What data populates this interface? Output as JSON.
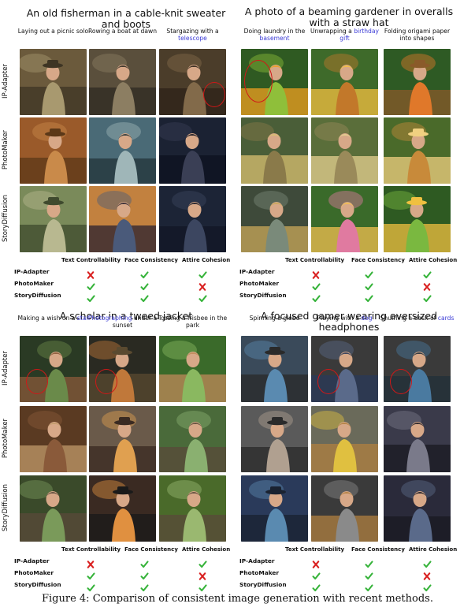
{
  "panels": [
    {
      "title": "An old fisherman in a cable-knit sweater and boots",
      "prompts": [
        {
          "pre": "Laying out a picnic solo",
          "hl": "",
          "post": ""
        },
        {
          "pre": "Rowing a boat at dawn",
          "hl": "",
          "post": ""
        },
        {
          "pre": "Stargazing with a ",
          "hl": "telescope",
          "post": ""
        }
      ],
      "methods": [
        "IP-Adapter",
        "PhotoMaker",
        "StoryDiffusion"
      ],
      "metrics": [
        "Text Controllability",
        "Face Consistency",
        "Attire Cohesion"
      ],
      "results": [
        [
          "fail",
          "pass",
          "pass"
        ],
        [
          "pass",
          "pass",
          "fail"
        ],
        [
          "pass",
          "pass",
          "pass"
        ]
      ]
    },
    {
      "title": "A photo of a beaming gardener in overalls with a straw hat",
      "prompts": [
        {
          "pre": "Doing laundry in the ",
          "hl": "basement",
          "post": ""
        },
        {
          "pre": "Unwrapping a ",
          "hl": "birthday gift",
          "post": ""
        },
        {
          "pre": "Folding origami paper into shapes",
          "hl": "",
          "post": ""
        }
      ],
      "methods": [
        "IP-Adapter",
        "PhotoMaker",
        "StoryDiffusion"
      ],
      "metrics": [
        "Text Controllability",
        "Face Consistency",
        "Attire Cohesion"
      ],
      "results": [
        [
          "fail",
          "pass",
          "pass"
        ],
        [
          "pass",
          "pass",
          "fail"
        ],
        [
          "pass",
          "pass",
          "pass"
        ]
      ]
    },
    {
      "title": "A scholar in a tweed jacket",
      "prompts": [
        {
          "pre": "Making a wish on a ",
          "hl": "star",
          "post": ""
        },
        {
          "pre": "",
          "hl": "Photographing",
          "post": " under a sunset"
        },
        {
          "pre": "Tossing a frisbee in the park",
          "hl": "",
          "post": ""
        }
      ],
      "methods": [
        "IP-Adapter",
        "PhotoMaker",
        "StoryDiffusion"
      ],
      "metrics": [
        "Text Controllability",
        "Face Consistency",
        "Attire Cohesion"
      ],
      "results": [
        [
          "fail",
          "pass",
          "pass"
        ],
        [
          "pass",
          "pass",
          "fail"
        ],
        [
          "pass",
          "pass",
          "pass"
        ]
      ]
    },
    {
      "title": "A focused gamer wearing oversized headphones",
      "prompts": [
        {
          "pre": "Spinning a globe",
          "hl": "",
          "post": ""
        },
        {
          "pre": "Playing with a ",
          "hl": "dog",
          "post": ""
        },
        {
          "pre": "Shuffling a deck of ",
          "hl": "cards",
          "post": ""
        }
      ],
      "methods": [
        "IP-Adapter",
        "PhotoMaker",
        "StoryDiffusion"
      ],
      "metrics": [
        "Text Controllability",
        "Face Consistency",
        "Attire Cohesion"
      ],
      "results": [
        [
          "fail",
          "pass",
          "pass"
        ],
        [
          "pass",
          "pass",
          "fail"
        ],
        [
          "pass",
          "pass",
          "pass"
        ]
      ]
    }
  ],
  "figure_caption": "Figure 4: Comparison of consistent image generation with recent methods.",
  "colors": {
    "highlight": "#3b3bd6",
    "pass": "#36b33a",
    "fail": "#d92020",
    "ring": "#d01818"
  }
}
